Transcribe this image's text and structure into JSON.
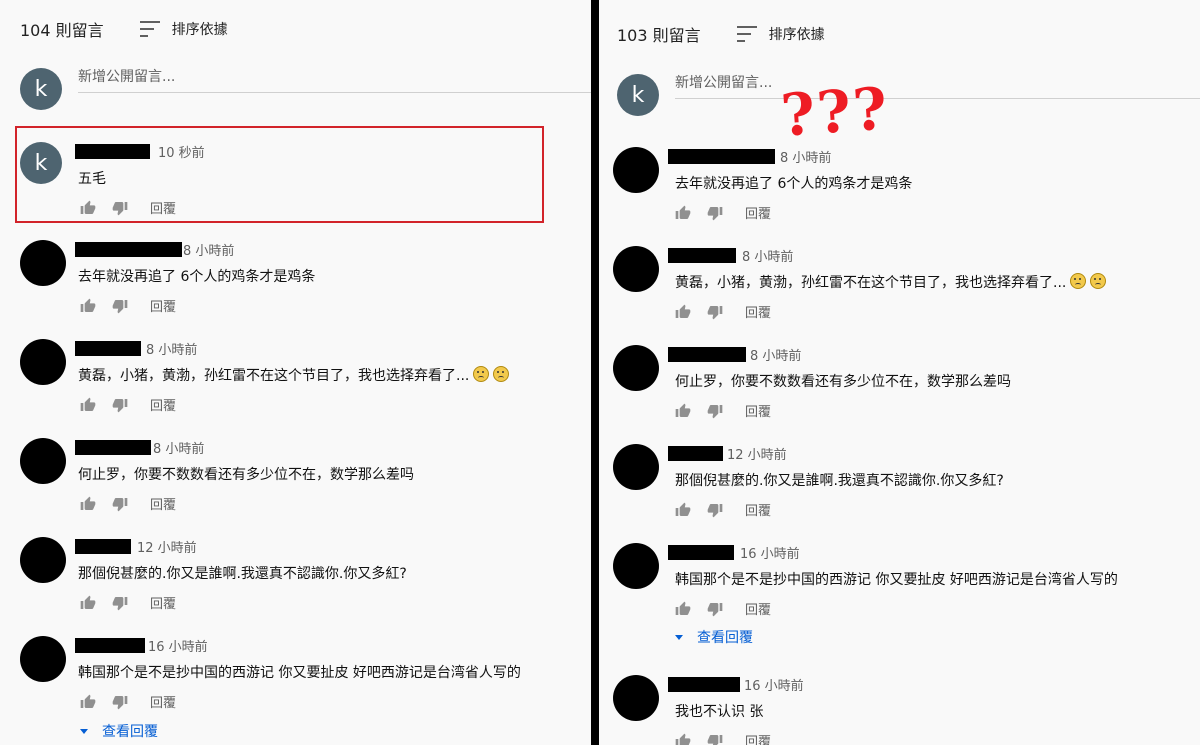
{
  "left": {
    "count_label": "104 則留言",
    "sort_label": "排序依據",
    "add_placeholder": "新增公開留言...",
    "user_initial": "k",
    "comments": [
      {
        "time": "10 秒前",
        "text": "五毛",
        "reply": "回覆"
      },
      {
        "time": "8 小時前",
        "text": "去年就没再追了 6个人的鸡条才是鸡条",
        "reply": "回覆"
      },
      {
        "time": "8 小時前",
        "text": "黄磊，小猪，黄渤，孙红雷不在这个节目了，我也选择弃看了...",
        "reply": "回覆"
      },
      {
        "time": "8 小時前",
        "text": "何止罗，你要不数数看还有多少位不在，数学那么差吗",
        "reply": "回覆"
      },
      {
        "time": "12 小時前",
        "text": "那個倪甚麼的.你又是誰啊.我還真不認識你.你又多紅?",
        "reply": "回覆"
      },
      {
        "time": "16 小時前",
        "text": "韩国那个是不是抄中国的西游记 你又要扯皮 好吧西游记是台湾省人写的",
        "reply": "回覆",
        "view_replies": "查看回覆"
      }
    ]
  },
  "right": {
    "count_label": "103 則留言",
    "sort_label": "排序依據",
    "add_placeholder": "新增公開留言...",
    "user_initial": "k",
    "annotation": "???",
    "comments": [
      {
        "time": "8 小時前",
        "text": "去年就没再追了 6个人的鸡条才是鸡条",
        "reply": "回覆"
      },
      {
        "time": "8 小時前",
        "text": "黄磊，小猪，黄渤，孙红雷不在这个节目了，我也选择弃看了...",
        "reply": "回覆"
      },
      {
        "time": "8 小時前",
        "text": "何止罗，你要不数数看还有多少位不在，数学那么差吗",
        "reply": "回覆"
      },
      {
        "time": "12 小時前",
        "text": "那個倪甚麼的.你又是誰啊.我還真不認識你.你又多紅?",
        "reply": "回覆"
      },
      {
        "time": "16 小時前",
        "text": "韩国那个是不是抄中国的西游记 你又要扯皮 好吧西游记是台湾省人写的",
        "reply": "回覆",
        "view_replies": "查看回覆"
      },
      {
        "time": "16 小時前",
        "text": "我也不认识 张",
        "reply": "回覆"
      }
    ]
  }
}
